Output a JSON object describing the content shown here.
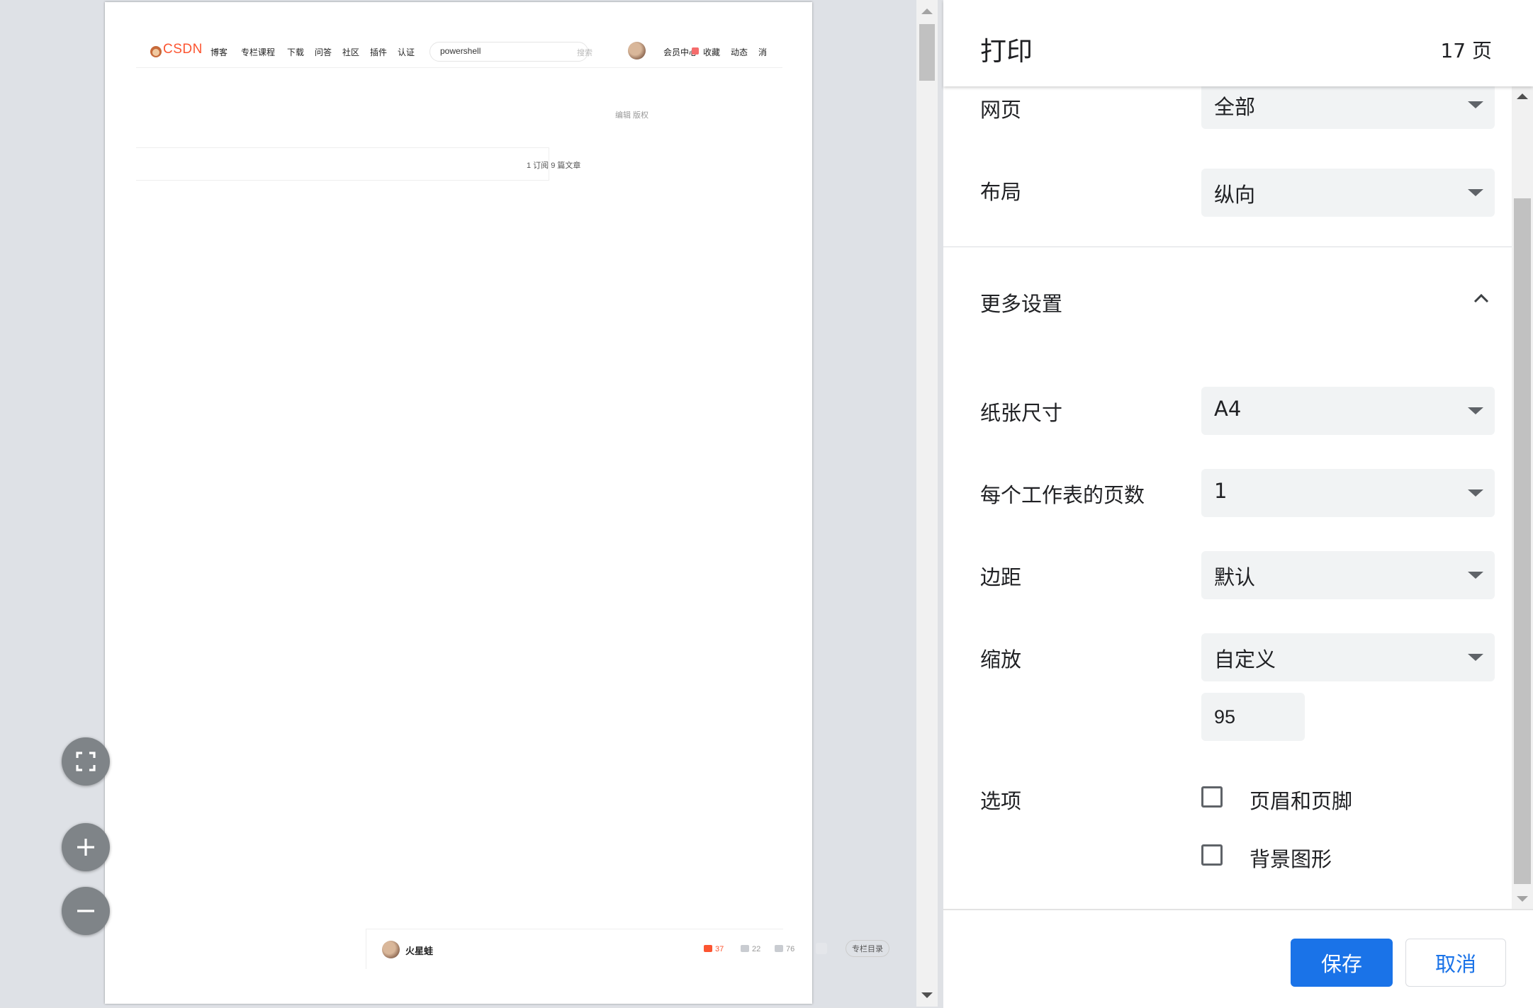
{
  "preview": {
    "page": {
      "logo": "CSDN",
      "nav": [
        "博客",
        "专栏课程",
        "下载",
        "问答",
        "社区",
        "插件",
        "认证"
      ],
      "search_value": "powershell",
      "search_button": "搜索",
      "user_nav": [
        "会员中心",
        "收藏",
        "动态",
        "消"
      ],
      "edit_links": "编辑  版权",
      "subscriptions": "1 订阅      9 篇文章",
      "author": "火星蛙",
      "likes": "37",
      "comments": "22",
      "favorites": "76",
      "column_menu": "专栏目录"
    }
  },
  "print": {
    "title": "打印",
    "page_count": "17 页",
    "settings": {
      "pages": {
        "label": "网页",
        "value": "全部"
      },
      "layout": {
        "label": "布局",
        "value": "纵向"
      },
      "more_settings": "更多设置",
      "paper_size": {
        "label": "纸张尺寸",
        "value": "A4"
      },
      "pages_per_sheet": {
        "label": "每个工作表的页数",
        "value": "1"
      },
      "margins": {
        "label": "边距",
        "value": "默认"
      },
      "scale": {
        "label": "缩放",
        "value": "自定义",
        "custom_value": "95"
      },
      "options": {
        "label": "选项",
        "headers_footers": {
          "label": "页眉和页脚",
          "checked": false
        },
        "background_graphics": {
          "label": "背景图形",
          "checked": false
        }
      }
    },
    "buttons": {
      "save": "保存",
      "cancel": "取消"
    }
  },
  "colors": {
    "accent": "#1a73e8",
    "csdn_brand": "#fc5531",
    "select_bg": "#f1f3f4"
  }
}
